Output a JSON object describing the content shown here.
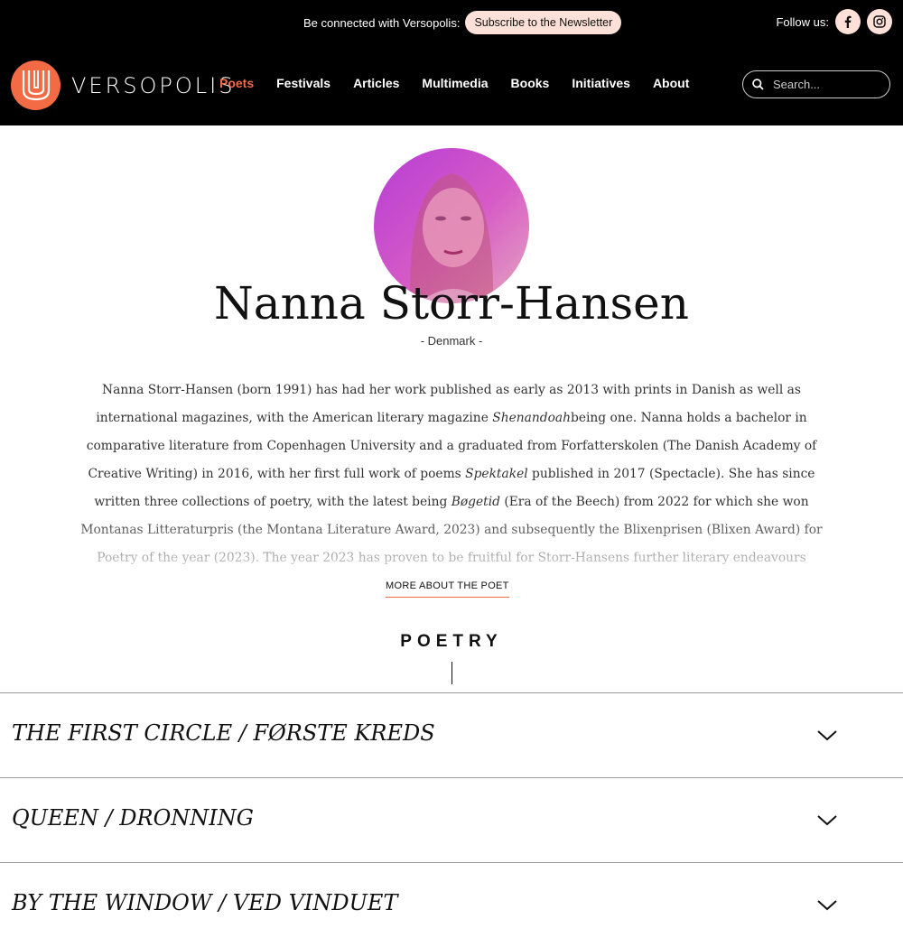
{
  "header": {
    "promo_text": "Be connected with Versopolis:",
    "subscribe_label": "Subscribe to the Newsletter",
    "follow_label": "Follow us:",
    "social": [
      "facebook-icon",
      "instagram-icon"
    ],
    "logo_text": "VERSOPOLIS",
    "nav": [
      "Poets",
      "Festivals",
      "Articles",
      "Multimedia",
      "Books",
      "Initiatives",
      "About"
    ],
    "active_nav": "Poets",
    "search_placeholder": "Search..."
  },
  "poet": {
    "name": "Nanna Storr-Hansen",
    "country": "- Denmark -",
    "bio": [
      {
        "t": "Nanna Storr-Hansen (born 1991) has had her work published as early as 2013 with prints in Danish as well as international magazines, with the American literary magazine "
      },
      {
        "t": "Shenandoah",
        "i": true
      },
      {
        "t": "being one. Nanna holds a bachelor in comparative literature from Copenhagen University and a graduated from Forfatterskolen (The Danish Academy of Creative Writing) in 2016, with her first full work of poems "
      },
      {
        "t": "Spektakel",
        "i": true
      },
      {
        "t": " published in 2017 (Spectacle). She has since written three collections of poetry, with the latest being "
      },
      {
        "t": "Bøgetid",
        "i": true
      },
      {
        "t": " (Era of the Beech) from 2022 for which she won Montanas Litteraturpris (the Montana Literature Award, 2023) and subsequently the Blixenprisen (Blixen Award) for Poetry of the year (2023). The year 2023 has proven to be fruitful for Storr-Hansens further literary endeavours where she received a three-year work grant"
      }
    ],
    "more_label": "MORE ABOUT THE POET"
  },
  "poetry": {
    "heading": "POETRY",
    "poems": [
      "THE FIRST CIRCLE / FØRSTE KREDS",
      "QUEEN / DRONNING",
      "BY THE WINDOW / VED VINDUET"
    ]
  },
  "colors": {
    "accent": "#f26b45",
    "pill": "#fde0d7",
    "topbar": "#000000"
  }
}
